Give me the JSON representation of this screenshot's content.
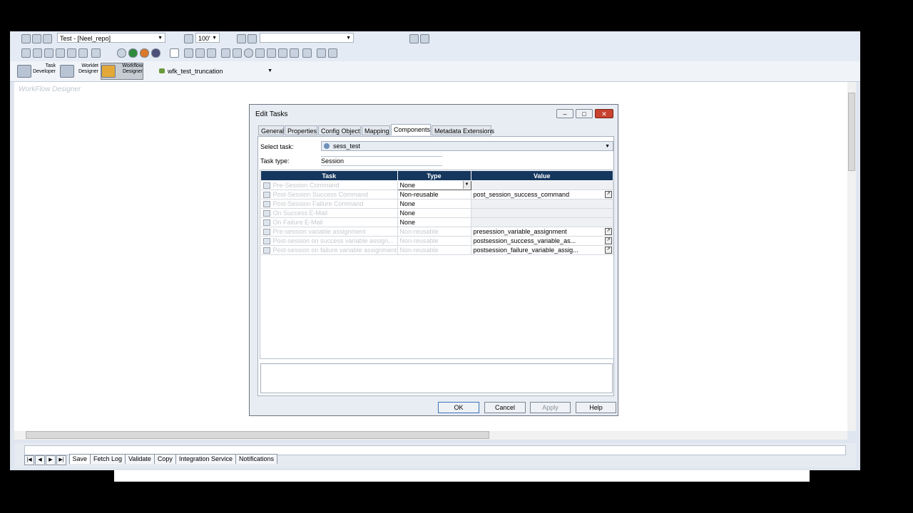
{
  "toolbar": {
    "repo_combo": "Test - [Neel_repo]",
    "zoom_combo": "100'",
    "tools": {
      "task_developer": "Task Developer",
      "worklet_designer": "Worklet Designer",
      "workflow_designer": "Workflow Designer"
    },
    "workflow_combo": "wfk_test_truncation"
  },
  "canvas": {
    "title": "WorkFlow Designer"
  },
  "dialog": {
    "title": "Edit Tasks",
    "tabs": [
      "General",
      "Properties",
      "Config Object",
      "Mapping",
      "Components",
      "Metadata Extensions"
    ],
    "selected_tab": "Components",
    "select_task_label": "Select task:",
    "select_task_value": "sess_test",
    "task_type_label": "Task type:",
    "task_type_value": "Session",
    "grid": {
      "headers": [
        "Task",
        "Type",
        "Value"
      ],
      "rows": [
        {
          "task": "Pre-Session Command",
          "type": "None",
          "value": ""
        },
        {
          "task": "Post-Session Success Command",
          "type": "Non-reusable",
          "value": "post_session_success_command"
        },
        {
          "task": "Post-Session Failure Command",
          "type": "None",
          "value": ""
        },
        {
          "task": "On Success E-Mail",
          "type": "None",
          "value": ""
        },
        {
          "task": "On Failure E-Mail",
          "type": "None",
          "value": ""
        },
        {
          "task": "Pre-session variable assignment",
          "type": "Non-reusable",
          "value": "presession_variable_assignment"
        },
        {
          "task": "Post-session on success variable assign...",
          "type": "Non-reusable",
          "value": "postsession_success_variable_as..."
        },
        {
          "task": "Post-session on failure variable assignment",
          "type": "Non-reusable",
          "value": "postsession_failure_variable_assig..."
        }
      ]
    },
    "buttons": {
      "ok": "OK",
      "cancel": "Cancel",
      "apply": "Apply",
      "help": "Help"
    }
  },
  "bottom_tabs": [
    "Save",
    "Fetch Log",
    "Validate",
    "Copy",
    "Integration Service",
    "Notifications"
  ]
}
